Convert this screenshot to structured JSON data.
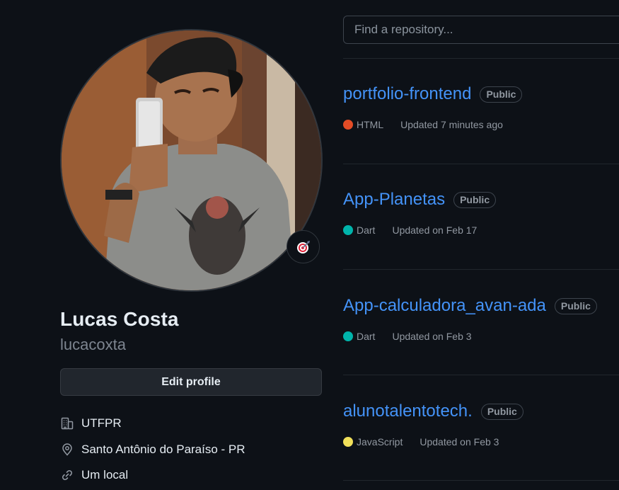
{
  "profile": {
    "name": "Lucas Costa",
    "login": "lucacoxta",
    "edit_label": "Edit profile",
    "status_emoji": "target-icon",
    "details": [
      {
        "icon": "organization-icon",
        "text": "UTFPR"
      },
      {
        "icon": "location-icon",
        "text": "Santo Antônio do Paraíso - PR"
      },
      {
        "icon": "link-icon",
        "text": "Um local"
      }
    ]
  },
  "repos": {
    "search_placeholder": "Find a repository...",
    "items": [
      {
        "name": "portfolio-frontend",
        "visibility": "Public",
        "language": "HTML",
        "lang_color": "#e34c26",
        "updated": "Updated 7 minutes ago"
      },
      {
        "name": "App-Planetas",
        "visibility": "Public",
        "language": "Dart",
        "lang_color": "#00b4ab",
        "updated": "Updated on Feb 17"
      },
      {
        "name": "App-calculadora_avan-ada",
        "visibility": "Public",
        "language": "Dart",
        "lang_color": "#00b4ab",
        "updated": "Updated on Feb 3"
      },
      {
        "name": "alunotalentotech.",
        "visibility": "Public",
        "language": "JavaScript",
        "lang_color": "#f1e05a",
        "updated": "Updated on Feb 3"
      }
    ]
  },
  "colors": {
    "background": "#0d1117",
    "link": "#4493f8",
    "muted": "#7d8590",
    "border": "#30363d"
  }
}
